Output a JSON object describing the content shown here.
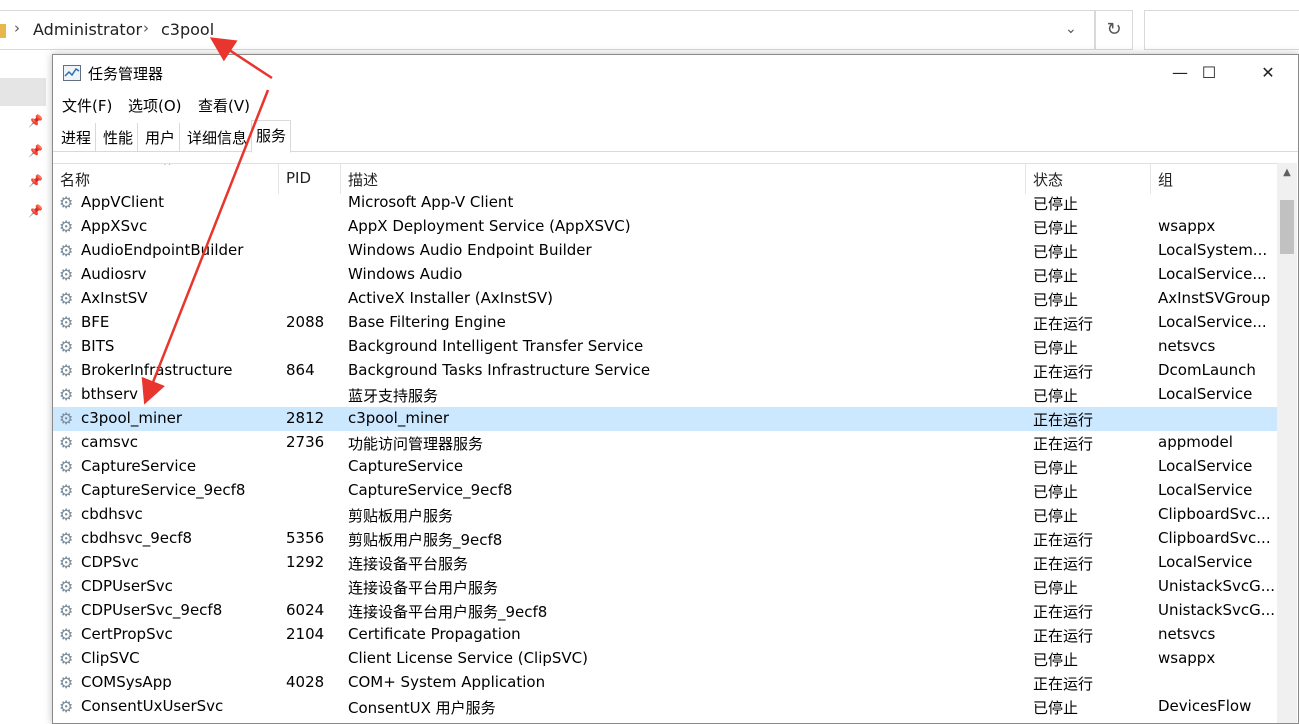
{
  "explorer": {
    "breadcrumb": [
      "Administrator",
      "c3pool"
    ],
    "refresh_icon": "↻",
    "dropdown_icon": "⌄"
  },
  "window": {
    "title": "任务管理器",
    "menu": [
      "文件(F)",
      "选项(O)",
      "查看(V)"
    ],
    "tabs": [
      "进程",
      "性能",
      "用户",
      "详细信息",
      "服务"
    ],
    "active_tab": "服务"
  },
  "columns": [
    "名称",
    "PID",
    "描述",
    "状态",
    "组"
  ],
  "rows": [
    {
      "name": "AppVClient",
      "pid": "",
      "desc": "Microsoft App-V Client",
      "status": "已停止",
      "group": ""
    },
    {
      "name": "AppXSvc",
      "pid": "",
      "desc": "AppX Deployment Service (AppXSVC)",
      "status": "已停止",
      "group": "wsappx"
    },
    {
      "name": "AudioEndpointBuilder",
      "pid": "",
      "desc": "Windows Audio Endpoint Builder",
      "status": "已停止",
      "group": "LocalSystem..."
    },
    {
      "name": "Audiosrv",
      "pid": "",
      "desc": "Windows Audio",
      "status": "已停止",
      "group": "LocalService..."
    },
    {
      "name": "AxInstSV",
      "pid": "",
      "desc": "ActiveX Installer (AxInstSV)",
      "status": "已停止",
      "group": "AxInstSVGroup"
    },
    {
      "name": "BFE",
      "pid": "2088",
      "desc": "Base Filtering Engine",
      "status": "正在运行",
      "group": "LocalService..."
    },
    {
      "name": "BITS",
      "pid": "",
      "desc": "Background Intelligent Transfer Service",
      "status": "已停止",
      "group": "netsvcs"
    },
    {
      "name": "BrokerInfrastructure",
      "pid": "864",
      "desc": "Background Tasks Infrastructure Service",
      "status": "正在运行",
      "group": "DcomLaunch"
    },
    {
      "name": "bthserv",
      "pid": "",
      "desc": "蓝牙支持服务",
      "status": "已停止",
      "group": "LocalService"
    },
    {
      "name": "c3pool_miner",
      "pid": "2812",
      "desc": "c3pool_miner",
      "status": "正在运行",
      "group": ""
    },
    {
      "name": "camsvc",
      "pid": "2736",
      "desc": "功能访问管理器服务",
      "status": "正在运行",
      "group": "appmodel"
    },
    {
      "name": "CaptureService",
      "pid": "",
      "desc": "CaptureService",
      "status": "已停止",
      "group": "LocalService"
    },
    {
      "name": "CaptureService_9ecf8",
      "pid": "",
      "desc": "CaptureService_9ecf8",
      "status": "已停止",
      "group": "LocalService"
    },
    {
      "name": "cbdhsvc",
      "pid": "",
      "desc": "剪贴板用户服务",
      "status": "已停止",
      "group": "ClipboardSvc..."
    },
    {
      "name": "cbdhsvc_9ecf8",
      "pid": "5356",
      "desc": "剪贴板用户服务_9ecf8",
      "status": "正在运行",
      "group": "ClipboardSvc..."
    },
    {
      "name": "CDPSvc",
      "pid": "1292",
      "desc": "连接设备平台服务",
      "status": "正在运行",
      "group": "LocalService"
    },
    {
      "name": "CDPUserSvc",
      "pid": "",
      "desc": "连接设备平台用户服务",
      "status": "已停止",
      "group": "UnistackSvcG..."
    },
    {
      "name": "CDPUserSvc_9ecf8",
      "pid": "6024",
      "desc": "连接设备平台用户服务_9ecf8",
      "status": "正在运行",
      "group": "UnistackSvcG..."
    },
    {
      "name": "CertPropSvc",
      "pid": "2104",
      "desc": "Certificate Propagation",
      "status": "正在运行",
      "group": "netsvcs"
    },
    {
      "name": "ClipSVC",
      "pid": "",
      "desc": "Client License Service (ClipSVC)",
      "status": "已停止",
      "group": "wsappx"
    },
    {
      "name": "COMSysApp",
      "pid": "4028",
      "desc": "COM+ System Application",
      "status": "正在运行",
      "group": ""
    },
    {
      "name": "ConsentUxUserSvc",
      "pid": "",
      "desc": "ConsentUX 用户服务",
      "status": "已停止",
      "group": "DevicesFlow"
    }
  ],
  "selected_row": 9,
  "colors": {
    "selection": "#cce8ff",
    "arrow": "#e8352e"
  }
}
